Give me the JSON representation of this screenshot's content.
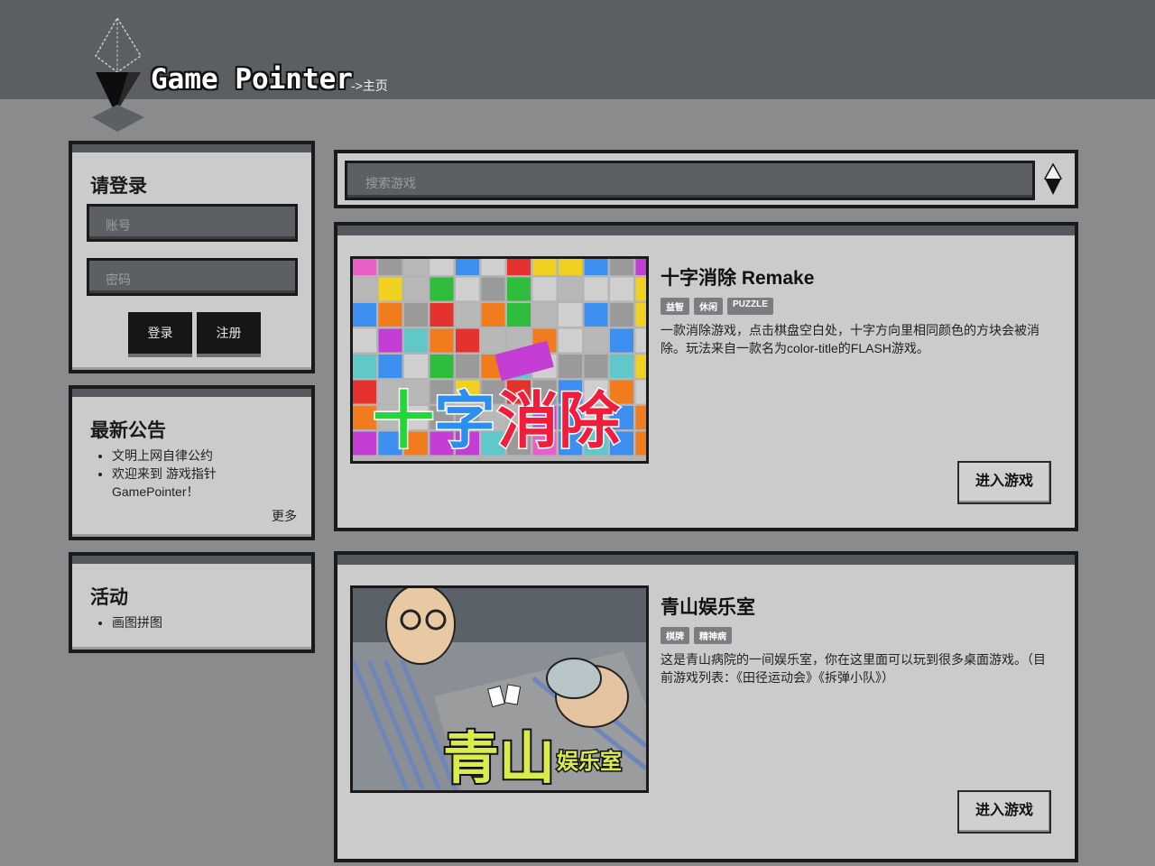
{
  "header": {
    "brand": "Game Pointer",
    "breadcrumb": "->主页"
  },
  "login": {
    "title": "请登录",
    "account_placeholder": "账号",
    "password_placeholder": "密码",
    "login_button": "登录",
    "register_button": "注册"
  },
  "announcements": {
    "title": "最新公告",
    "items": [
      "文明上网自律公约",
      "欢迎来到 游戏指针",
      "GamePointer！"
    ],
    "more": "更多"
  },
  "activities": {
    "title": "活动",
    "items": [
      "画图拼图"
    ]
  },
  "search": {
    "placeholder": "搜索游戏",
    "icon": "pointer-icon"
  },
  "games": [
    {
      "title": "十字消除 Remake",
      "tags": [
        "益智",
        "休闲",
        "PUZZLE"
      ],
      "description": "一款消除游戏，点击棋盘空白处，十字方向里相同颜色的方块会被消除。玩法来自一款名为color-title的FLASH游戏。",
      "thumb_text": "十字消除",
      "enter_button": "进入游戏"
    },
    {
      "title": "青山娱乐室",
      "tags": [
        "棋牌",
        "精神病"
      ],
      "description": "这是青山病院的一间娱乐室，你在这里面可以玩到很多桌面游戏。（目前游戏列表：《田径运动会》《拆弹小队》）",
      "thumb_text_main": "青山",
      "thumb_text_sub": "娱乐室",
      "enter_button": "进入游戏"
    }
  ]
}
